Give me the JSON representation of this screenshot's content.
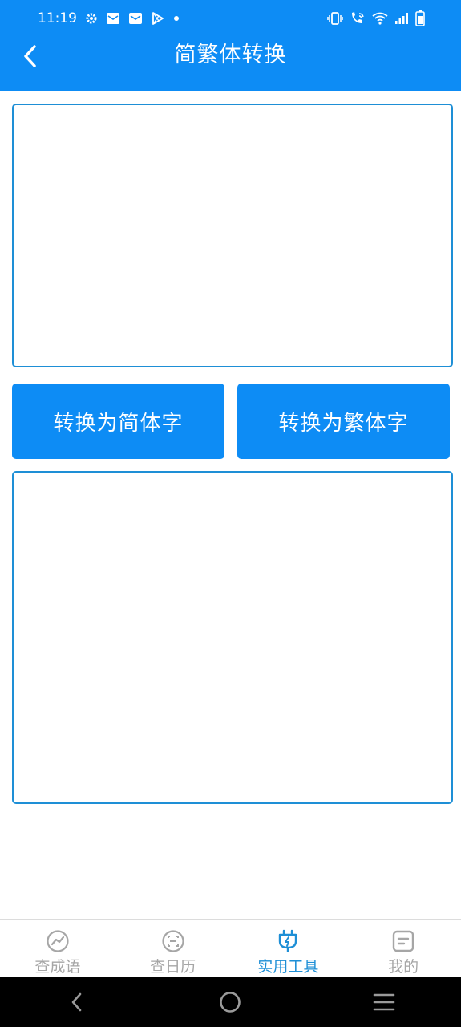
{
  "status_bar": {
    "time": "11:19",
    "icons_left": [
      "gear-icon",
      "mail-icon",
      "mail-icon",
      "play-store-icon",
      "dot-icon"
    ],
    "icons_right": [
      "vibrate-icon",
      "wifi-call-icon",
      "wifi-icon",
      "signal-icon",
      "battery-icon"
    ]
  },
  "header": {
    "title": "简繁体转换",
    "back_icon": "chevron-left-icon"
  },
  "input": {
    "value": "",
    "placeholder": ""
  },
  "buttons": {
    "to_simplified": "转换为简体字",
    "to_traditional": "转换为繁体字"
  },
  "output": {
    "value": "",
    "placeholder": ""
  },
  "bottom_nav": {
    "items": [
      {
        "label": "查成语",
        "icon": "chart-circle-icon",
        "active": false
      },
      {
        "label": "查日历",
        "icon": "face-scan-icon",
        "active": false
      },
      {
        "label": "实用工具",
        "icon": "plug-bolt-icon",
        "active": true
      },
      {
        "label": "我的",
        "icon": "document-icon",
        "active": false
      }
    ]
  },
  "system_nav": {
    "back": "back-icon",
    "home": "home-icon",
    "recents": "menu-icon"
  },
  "colors": {
    "primary": "#0d8cf5",
    "border": "#1e8fd6",
    "nav_inactive": "#a6a6a6"
  }
}
